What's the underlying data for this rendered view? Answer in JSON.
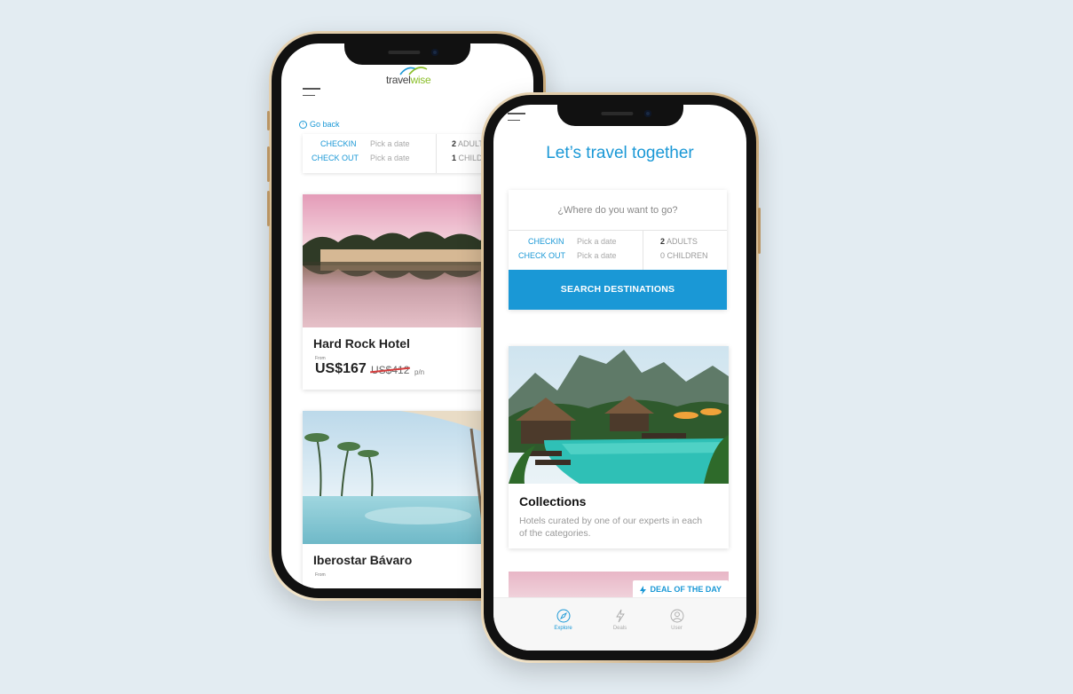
{
  "back_screen": {
    "logo": {
      "part1": "travel",
      "part2": "wise",
      "brand_color": "#8bbf2a"
    },
    "go_back_label": "Go back",
    "dates": {
      "checkin_label": "CHECKIN",
      "checkout_label": "CHECK OUT",
      "checkin_value": "Pick a date",
      "checkout_value": "Pick a date",
      "adults_count": "2",
      "adults_label": "ADULT",
      "children_count": "1",
      "children_label": "CHILD"
    },
    "hotels": [
      {
        "name": "Hard Rock Hotel",
        "from": "From",
        "price": "US$167",
        "old_price": "US$412",
        "per": "p/n"
      },
      {
        "name": "Iberostar Bávaro",
        "from": "From"
      }
    ]
  },
  "front_screen": {
    "headline": "Let’s travel together",
    "search": {
      "placeholder": "¿Where do you want to go?",
      "checkin_label": "CHECKIN",
      "checkout_label": "CHECK OUT",
      "checkin_value": "Pick a date",
      "checkout_value": "Pick a date",
      "adults_count": "2",
      "adults_label": "ADULTS",
      "children_count": "0",
      "children_label": "CHILDREN",
      "button_label": "SEARCH DESTINATIONS"
    },
    "collections": {
      "title": "Collections",
      "description": "Hotels curated by one of our experts in each of the categories."
    },
    "deal_badge": "DEAL OF THE DAY",
    "tabs": [
      {
        "label": "Explore",
        "icon": "compass-icon",
        "active": true
      },
      {
        "label": "Deals",
        "icon": "lightning-icon",
        "active": false
      },
      {
        "label": "User",
        "icon": "user-icon",
        "active": false
      }
    ]
  },
  "colors": {
    "accent": "#1a98d6",
    "background": "#e3ecf2"
  }
}
